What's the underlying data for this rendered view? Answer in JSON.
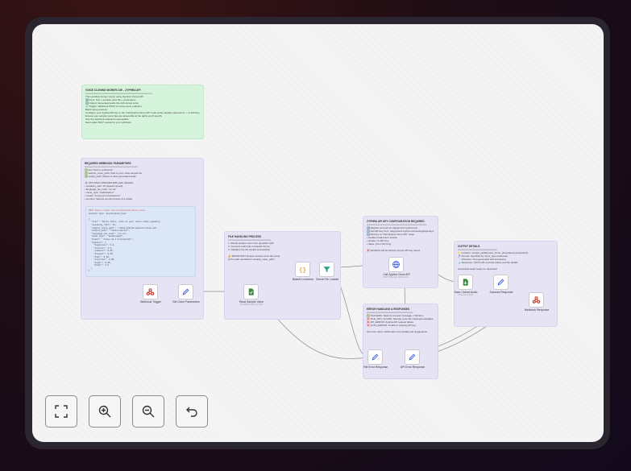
{
  "notes": {
    "voice_clone": {
      "title": "VOICE CLONING WORKFLOW – ZYPHRA API",
      "lines": [
        "═══════════════════════════════════════",
        "This workflow clones voices using Zyphra's Zonos API",
        "1️⃣ Input: Text + sample voice file + parameters",
        "2️⃣ Output: Generated audio file with cloned voice",
        "🔗 Trigger: Webhook POST to /voice-clone endpoint",
        "",
        "Basic setup process:",
        "Configure your Zyphra API key in the 'Call Zyphra Clone API' node under Header parameters -> X-API-Key header parameter",
        "",
        "Ensure your sample voice files are accessible at the paths you'll specify",
        "",
        "Test the webhook endpoint is accessible",
        "",
        "Send valid POST request to your webhook"
      ]
    },
    "params": {
      "title": "REQUIRED WEBHOOK PARAMETERS",
      "lines": [
        "═══════════════════════════════",
        "✅ text: Text to synthesize",
        "✅ sample_voice_path: Path to your voice sample file",
        "✅ output_path: Where to save generated audio",
        "",
        "⚙️ OPTIONAL PARAMETERS (with defaults)",
        "• speaking_rate: 15 (speech speed)",
        "• language_iso_code: \"en-us\"",
        "• mime_type: \"audio/webm\"",
        "• model: \"zonos-v0.1-transformer\"",
        "• emotion: Various emotion levels (0-1 scale)"
      ]
    },
    "file_process": {
      "title": "FILE HANDLING PROCESS",
      "lines": [
        "═════════════════════════",
        "1. Reads sample voice from specified path",
        "2. Converts audio file to base64 format",
        "3. Validates the file loaded successfully",
        "",
        "⚠️ IMPORTANT: Ensure sample voice file exists",
        "at the path specified in sample_voice_path!"
      ]
    },
    "api_key": {
      "title": "ZYPHRA API KEY CONFIGURATION REQUIRED",
      "lines": [
        "═══════════════════════════════════",
        "1️⃣ Register account at: playground.zyphra.com",
        "2️⃣ Get API key from: playground.zyphra.com/settings/api-keys",
        "3️⃣ Add key to \"Call Zyphra Clone API\" node:",
        "  • Header parameters section",
        "  • Header: X-API-Key",
        "  • Value: [Your API Key]",
        "",
        "❌ Workflow will fail without proper API key setup!"
      ]
    },
    "output": {
      "title": "OUTPUT DETAILS",
      "lines": [
        "═══════════════════════",
        "📁 Location: {output_path}/{voice_clone_{timestamp}.{ext}/webm}",
        "🎵 Format: Specified by mime_type parameter",
        "⏱️ Filename: Auto-generated with timestamp",
        "📊 Response: JSON with success status and file details",
        "",
        "Generated audio ready for download"
      ]
    },
    "errors": {
      "title": "ERROR HANDLING & RESPONSES",
      "lines": [
        "═══════════════════════════",
        "✅ SUCCESS: Returns success message + filename",
        "❌ FILE_NOT_FOUND: Sample voice file missing/unreadable",
        "❌ API_ERROR: Zyphra API request failure",
        "❌ AUTH_ERROR: Invalid or missing API key",
        "",
        "All errors return JSON with error details and suggestions"
      ]
    }
  },
  "code_sample": {
    "lines": [
      "POST https://your-n8n-url/webhook/voice-clone",
      "Content-Type: application/json",
      "",
      "{",
      "  \"text\": \"Hello there, this is your voice clone speaking",
      "  \"speaking_rate\": 15,",
      "  \"sample_voice_path\": \"/data/shared/samples/voice.wav",
      "  \"output_path\": \"/data/shared/\",",
      "  \"language_iso_code\": \"en-us\",",
      "  \"mime_type\": \"audio/webm\",",
      "  \"model\": \"zonos-v0.1-transformer\",",
      "  \"emotion\": {",
      "    \"happiness\": 0.8,",
      "    \"neutral\": 0.3,",
      "    \"sadness\": 0.05,",
      "    \"disgust\": 0.05,",
      "    \"fear\": 0.05,",
      "    \"surprise\": 0.05,",
      "    \"anger\": 0.05,",
      "    \"other\": 0.5",
      "  }",
      "}"
    ]
  },
  "nodes": {
    "webhook_trigger": {
      "label": "Webhook Trigger",
      "icon": "webhook-icon"
    },
    "set_clone_params": {
      "label": "Set Clone Parameters",
      "icon": "pencil-icon"
    },
    "read_sample_voice": {
      "label": "Read Sample Voice",
      "sub": "Read/Write Files from Disk",
      "icon": "file-read-icon"
    },
    "base64_convertor": {
      "label": "Base64 convertor",
      "icon": "braces-icon"
    },
    "check_file_loaded": {
      "label": "Check File Loaded",
      "icon": "filter-icon"
    },
    "call_zyphra_api": {
      "label": "Call Zyphra Clone API",
      "sub": "POST: https://api.zyphra.com/...",
      "icon": "globe-icon"
    },
    "save_cloned_audio": {
      "label": "Save Cloned Audio",
      "sub": "Write File to Disk",
      "icon": "file-save-icon"
    },
    "success_response": {
      "label": "Success Response",
      "icon": "pencil-icon"
    },
    "webhook_response": {
      "label": "Webhook Response",
      "icon": "webhook-icon"
    },
    "file_error_response": {
      "label": "File Error Response",
      "icon": "pencil-icon"
    },
    "api_error_response": {
      "label": "API Error Response",
      "icon": "pencil-icon"
    }
  },
  "controls": {
    "fit_view": "fit-view-icon",
    "zoom_in": "zoom-in-icon",
    "zoom_out": "zoom-out-icon",
    "undo": "undo-icon"
  },
  "colors": {
    "accent_green": "#d6f3dc",
    "accent_purple": "#e6e3f4",
    "code_blue": "#dbe6f6",
    "wire": "#8b8b92",
    "webhook_red": "#c0392b",
    "node_green": "#3c8a3e",
    "node_amber": "#e5a431",
    "node_teal": "#2a9d8f",
    "node_blue": "#3b5bdb"
  }
}
